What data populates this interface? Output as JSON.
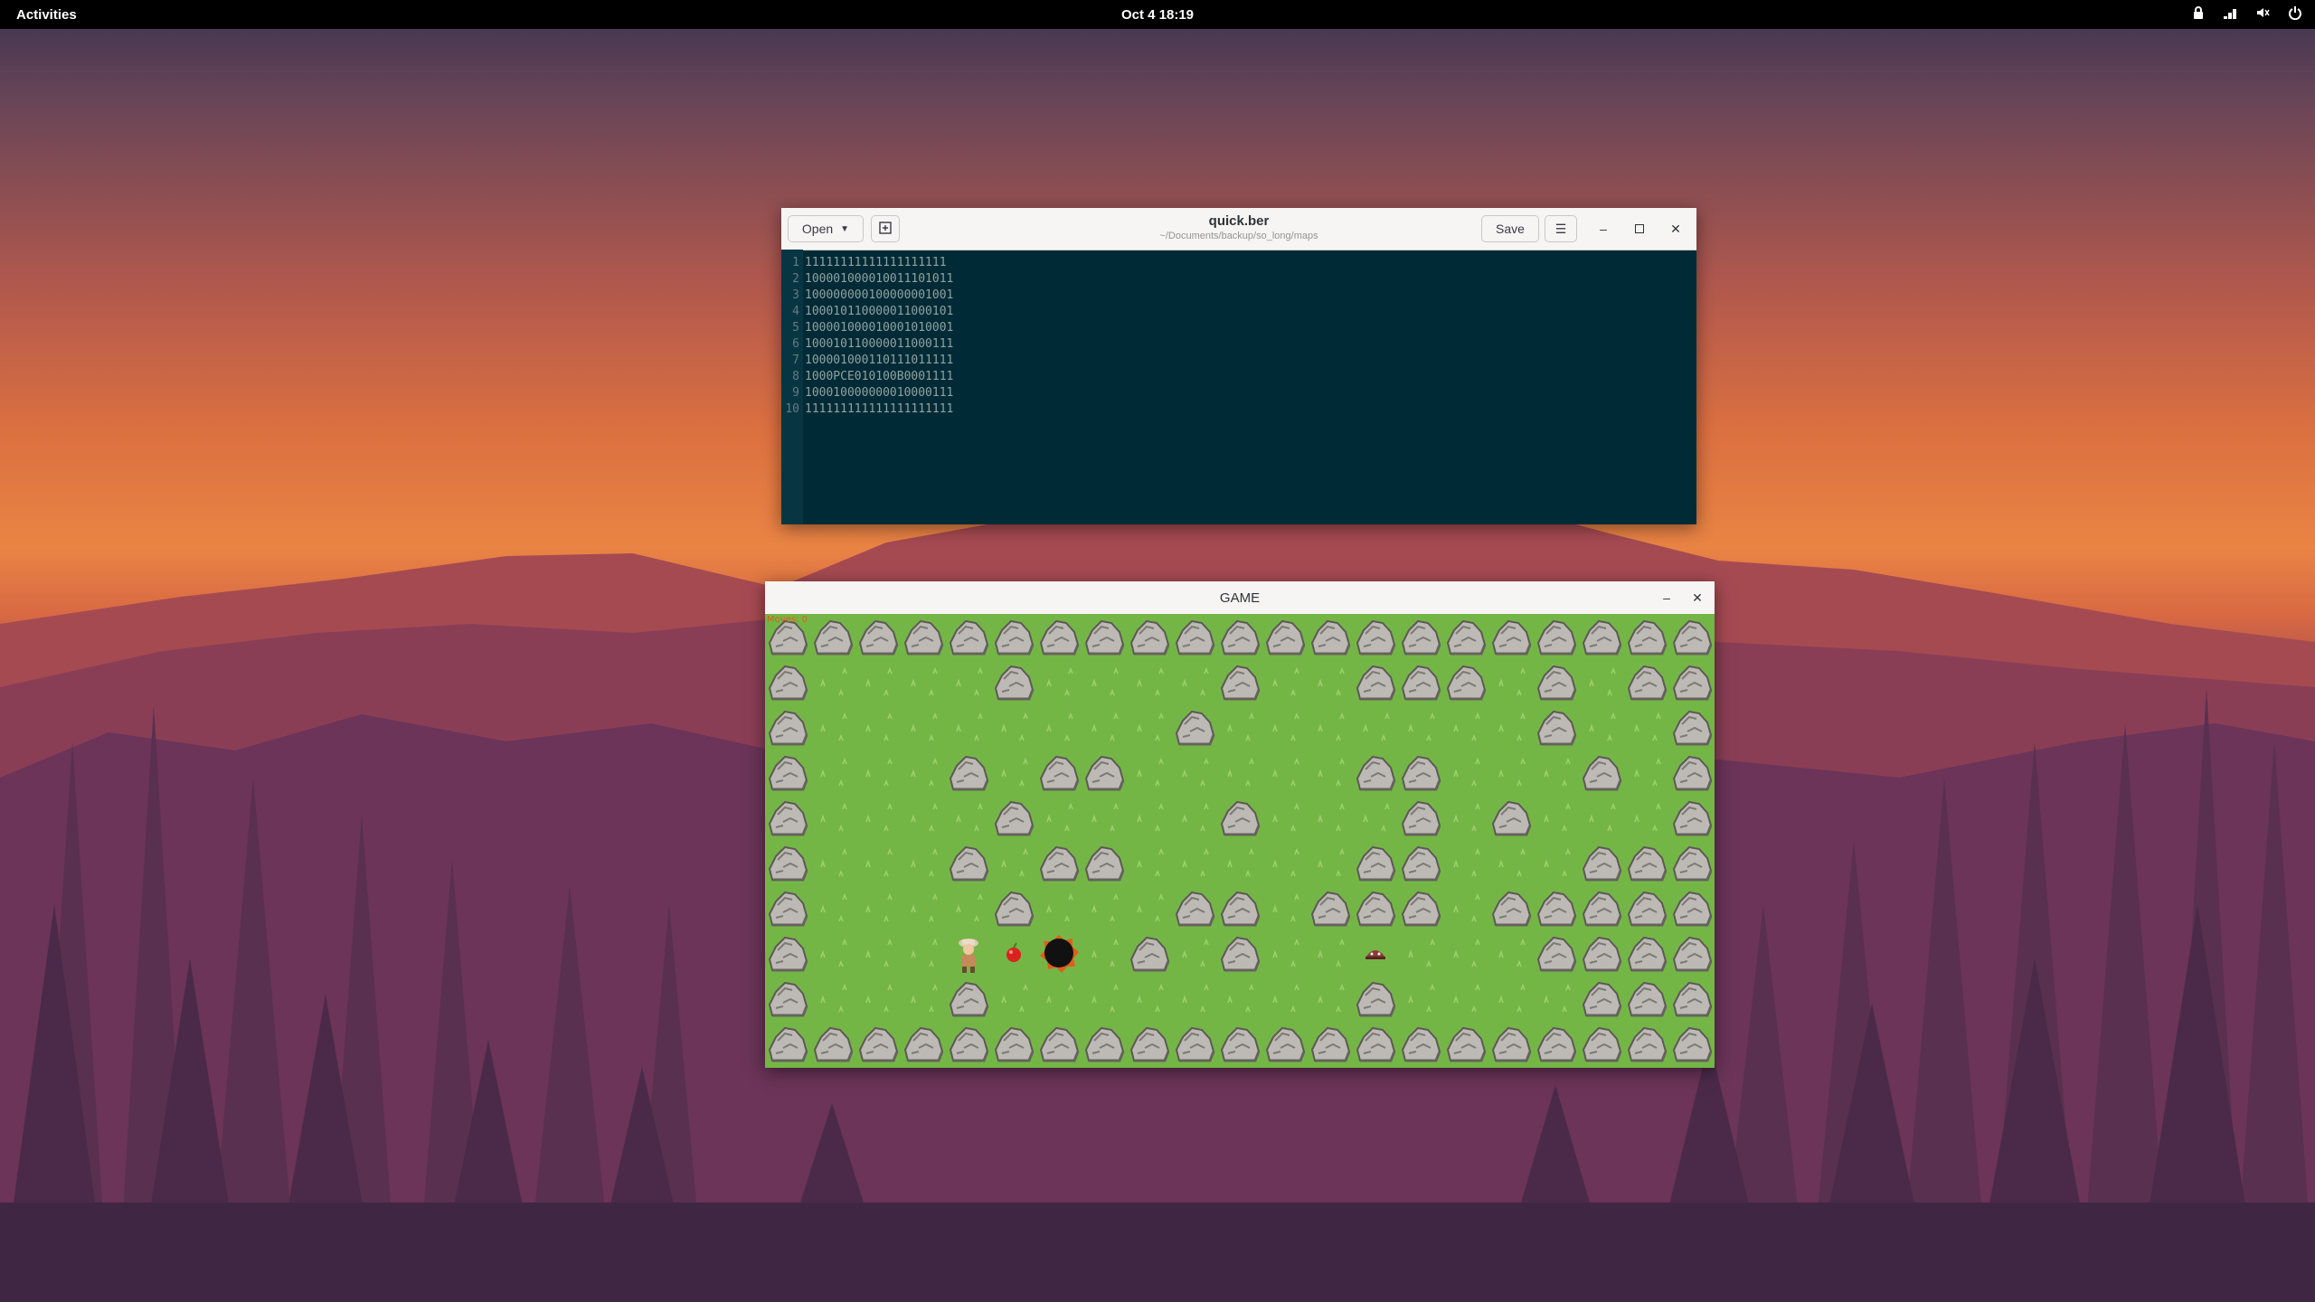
{
  "topbar": {
    "activities": "Activities",
    "clock": "Oct 4  18:19",
    "icons": [
      "lock-icon",
      "volume-icon",
      "network-icon",
      "power-icon"
    ]
  },
  "editor": {
    "open_label": "Open",
    "title": "quick.ber",
    "subtitle": "~/Documents/backup/so_long/maps",
    "save_label": "Save",
    "lines": [
      {
        "n": "1",
        "text": "11111111111111111111"
      },
      {
        "n": "2",
        "text": "10000100001001110101 1"
      },
      {
        "n": "3",
        "text": "10000000010000000100 1"
      },
      {
        "n": "4",
        "text": "10001011000001100010 1"
      },
      {
        "n": "5",
        "text": "10000100001000101000 1"
      },
      {
        "n": "6",
        "text": "10001011000001100011 1"
      },
      {
        "n": "7",
        "text": "10000100011011101111 1"
      },
      {
        "n": "8",
        "text": "1000PCE010100B000111 1"
      },
      {
        "n": "9",
        "text": "10001000000001000011 1"
      },
      {
        "n": "10",
        "text": "11111111111111111111 1"
      }
    ]
  },
  "game": {
    "title": "GAME",
    "moves": "Moves: 0",
    "map": [
      "111111111111111111111",
      "100001000010011101011",
      "100000000100000001001",
      "100010110000011000101",
      "100001000010001010001",
      "100010110000011000111",
      "100001000110111011111",
      "1000PCE010100B0001111",
      "100010000000010000111",
      "111111111111111111111"
    ]
  },
  "colors": {
    "editor_bg": "#002b36",
    "grass": "#74b646",
    "rock": "#b9b5b1",
    "accent_orange": "#e25b1b"
  }
}
